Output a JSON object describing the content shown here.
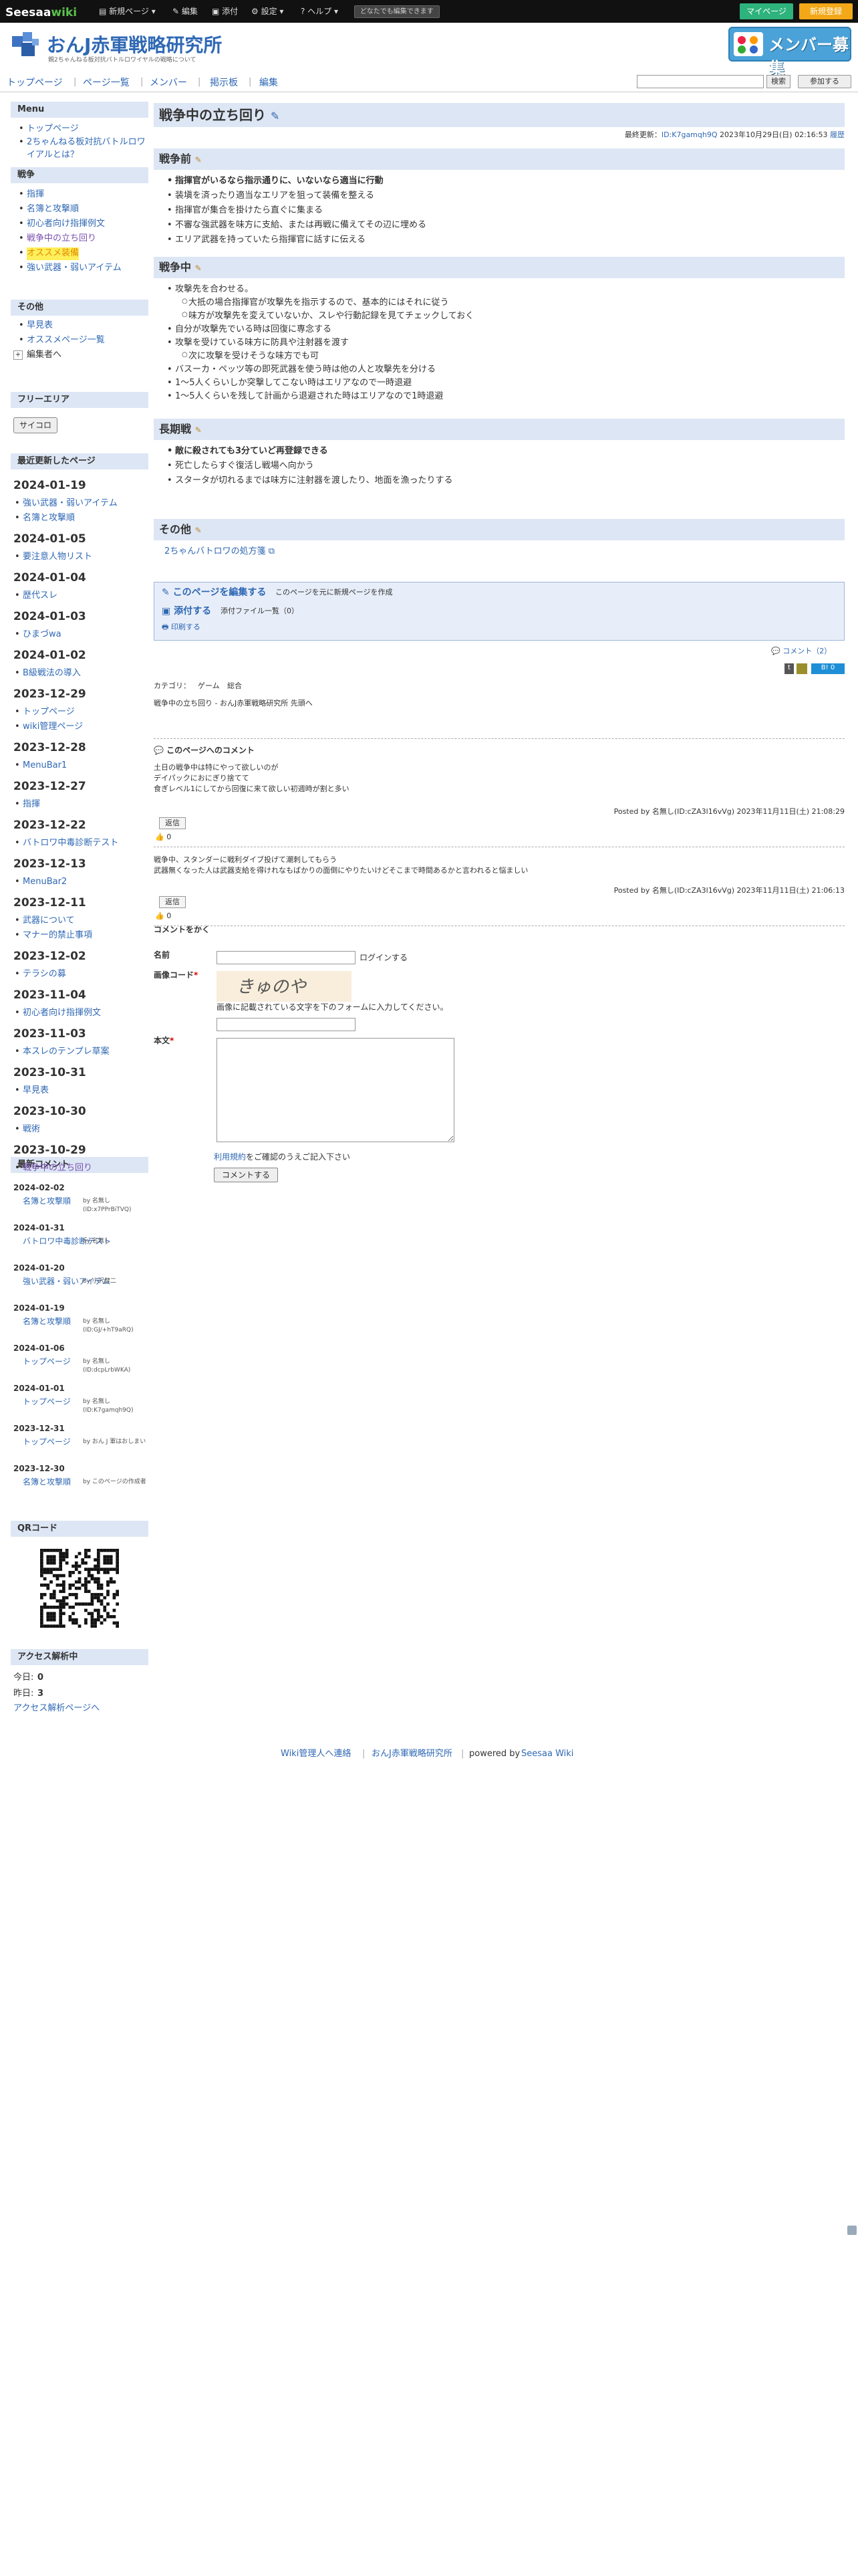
{
  "topbar": {
    "logo_a": "Seesaa",
    "logo_b": "wiki",
    "items": [
      "新規ページ ▾",
      "編集",
      "添付",
      "設定 ▾",
      "ヘルプ ▾"
    ],
    "hint": "どなたでも編集できます",
    "mypage": "マイページ",
    "signup": "新規登録"
  },
  "site": {
    "title": "おんJ赤軍戦略研究所",
    "subtitle": "親2ちゃんねる板対抗バトルロワイヤルの戦略について",
    "banner": "メンバー募集"
  },
  "nav": {
    "items": [
      "トップページ",
      "ページ一覧",
      "メンバー",
      "掲示板",
      "編集"
    ],
    "search_btn": "検索",
    "join": "参加する"
  },
  "sidebar": {
    "menu_head": "Menu",
    "menu_links": [
      "トップページ",
      "2ちゃんねる板対抗バトルロワイアルとは？"
    ],
    "war_head": "戦争",
    "war_links": [
      "指揮",
      "名簿と攻撃順",
      "初心者向け指揮例文",
      "戦争中の立ち回り",
      "オススメ装備",
      "強い武器・弱いアイテム"
    ],
    "other_head": "その他",
    "other_links": [
      "早見表",
      "オススメページ一覧"
    ],
    "editor_link": "編集者へ",
    "free_head": "フリーエリア",
    "free_btn": "サイコロ",
    "recent_head": "最近更新したページ",
    "recent": [
      {
        "date": "2024-01-19",
        "links": [
          "強い武器・弱いアイテム",
          "名簿と攻撃順"
        ]
      },
      {
        "date": "2024-01-05",
        "links": [
          "要注意人物リスト"
        ]
      },
      {
        "date": "2024-01-04",
        "links": [
          "歴代スレ"
        ]
      },
      {
        "date": "2024-01-03",
        "links": [
          "ひまづwa"
        ]
      },
      {
        "date": "2024-01-02",
        "links": [
          "B級戦法の導入"
        ]
      },
      {
        "date": "2023-12-29",
        "links": [
          "トップページ",
          "wiki管理ページ"
        ]
      },
      {
        "date": "2023-12-28",
        "links": [
          "MenuBar1"
        ]
      },
      {
        "date": "2023-12-27",
        "links": [
          "指揮"
        ]
      },
      {
        "date": "2023-12-22",
        "links": [
          "バトロワ中毒診断テスト"
        ]
      },
      {
        "date": "2023-12-13",
        "links": [
          "MenuBar2"
        ]
      },
      {
        "date": "2023-12-11",
        "links": [
          "武器について",
          "マナー的禁止事項"
        ]
      },
      {
        "date": "2023-12-02",
        "links": [
          "テラシの募"
        ]
      },
      {
        "date": "2023-11-04",
        "links": [
          "初心者向け指揮例文"
        ]
      },
      {
        "date": "2023-11-03",
        "links": [
          "本スレのテンプレ草案"
        ]
      },
      {
        "date": "2023-10-31",
        "links": [
          "早見表"
        ]
      },
      {
        "date": "2023-10-30",
        "links": [
          "戦術"
        ]
      },
      {
        "date": "2023-10-29",
        "links": [
          "戦争中の立ち回り"
        ]
      }
    ],
    "comments_head": "最新コメント",
    "comments": [
      {
        "date": "2024-02-02",
        "link": "名簿と攻撃順",
        "by": "by 名無し(ID:x7PPrBiTVQ)"
      },
      {
        "date": "2024-01-31",
        "link": "バトロワ中毒診断テスト",
        "by": "by 名無し"
      },
      {
        "date": "2024-01-20",
        "link": "強い武器・弱いアイテム",
        "by": "by 小沢健二"
      },
      {
        "date": "2024-01-19",
        "link": "名簿と攻撃順",
        "by": "by 名無し(ID:GJ/+hT9aRQ)"
      },
      {
        "date": "2024-01-06",
        "link": "トップページ",
        "by": "by 名無し(ID:dcpLrbWKA)"
      },
      {
        "date": "2024-01-01",
        "link": "トップページ",
        "by": "by 名無し(ID:K7gamqh9Q)"
      },
      {
        "date": "2023-12-31",
        "link": "トップページ",
        "by": "by おん J 軍はおしまい"
      },
      {
        "date": "2023-12-30",
        "link": "名簿と攻撃順",
        "by": "by このページの作成者"
      }
    ],
    "qr_head": "QRコード",
    "access_head": "アクセス解析中",
    "today_label": "今日:",
    "today": "0",
    "yesterday_label": "昨日:",
    "yesterday": "3",
    "access_link": "アクセス解析ページへ"
  },
  "page": {
    "title": "戦争中の立ち回り",
    "updated_label": "最終更新：",
    "updated_id": "ID:K7gamqh9Q",
    "updated_time": "2023年10月29日(日) 02:16:53",
    "history": "履歴",
    "sec1": "戦争前",
    "sec1_items": [
      "指揮官がいるなら指示通りに、いないなら適当に行動",
      "装塡を済ったり適当なエリアを狙って装備を整える",
      "指揮官が集合を掛けたら直ぐに集まる",
      "不審な強武器を味方に支給、または再戦に備えてその辺に埋める",
      "エリア武器を持っていたら指揮官に話すに伝える"
    ],
    "sec2": "戦争中",
    "sec2_items": [
      "攻撃先を合わせる。",
      "自分が攻撃先でいる時は回復に専念する",
      "攻撃を受けている味方に防具や注射器を渡す",
      "バスーカ・ペッツ等の即死武器を使う時は他の人と攻撃先を分ける",
      "1～5人くらいしか突撃してこない時はエリアなので一時退避",
      "1～5人くらいを残して計画から退避された時はエリアなので1時退避"
    ],
    "sec2_sub1": [
      "大抵の場合指揮官が攻撃先を指示するので、基本的にはそれに従う",
      "味方が攻撃先を変えていないか、スレや行動記録を見てチェックしておく"
    ],
    "sec2_sub2": [
      "次に攻撃を受けそうな味方でも可"
    ],
    "sec3": "長期戦",
    "sec3_items": [
      "敵に殺されても3分ていど再登録できる",
      "死亡したらすぐ復活し戦場へ向かう",
      "スタータが切れるまでは味方に注射器を渡したり、地面を漁ったりする"
    ],
    "sec4": "その他",
    "sec4_link": "2ちゃんバトロワの処方箋",
    "edit_title": "このページを編集する",
    "edit_sub": "このページを元に新規ページを作成",
    "attach_title": "添付する",
    "attach_sub": "添付ファイル一覧（0）",
    "print": "印刷する",
    "comment_count": "コメント（2）",
    "category_label": "カテゴリ：",
    "categories": [
      "ゲーム",
      "総合"
    ],
    "breadcrumb": "戦争中の立ち回り - おんJ赤軍戦略研究所 先頭へ",
    "like_count": "0"
  },
  "comments": {
    "head": "このページへのコメント",
    "list": [
      {
        "text": "土日の戦争中は特にやって欲しいのが\nデイパックにおにぎり捨てて\n食ぎレベル1にしてから回復に来て欲しい初週時が割と多い",
        "meta": "Posted by 名無し(ID:cZA3l16vVg) 2023年11月11日(土) 21:08:29",
        "good": "0"
      },
      {
        "text": "戦争中、スタンダーに戦利ダイブ投げて潮刺してもらう\n武器無くなった人は武器支給を得けれなもばかりの面倒にやりたいけどそこまで時間あるかと言われると悩ましい",
        "meta": "Posted by 名無し(ID:cZA3l16vVg) 2023年11月11日(土) 21:06:13",
        "good": "0"
      }
    ],
    "reply": "返信",
    "form_head": "コメントをかく",
    "name_label": "名前",
    "login": "ログインする",
    "captcha_label": "画像コード",
    "captcha_text": "きゅのや",
    "captcha_hint": "画像に記載されている文字を下のフォームに入力してください。",
    "body_label": "本文",
    "terms_link": "利用規約",
    "terms_text": "をご確認のうえご記入下さい",
    "submit": "コメントする"
  },
  "footer": {
    "admin": "Wiki管理人へ連絡",
    "site": "おんJ赤軍戦略研究所",
    "powered": "powered by",
    "seesaa": "Seesaa Wiki"
  }
}
